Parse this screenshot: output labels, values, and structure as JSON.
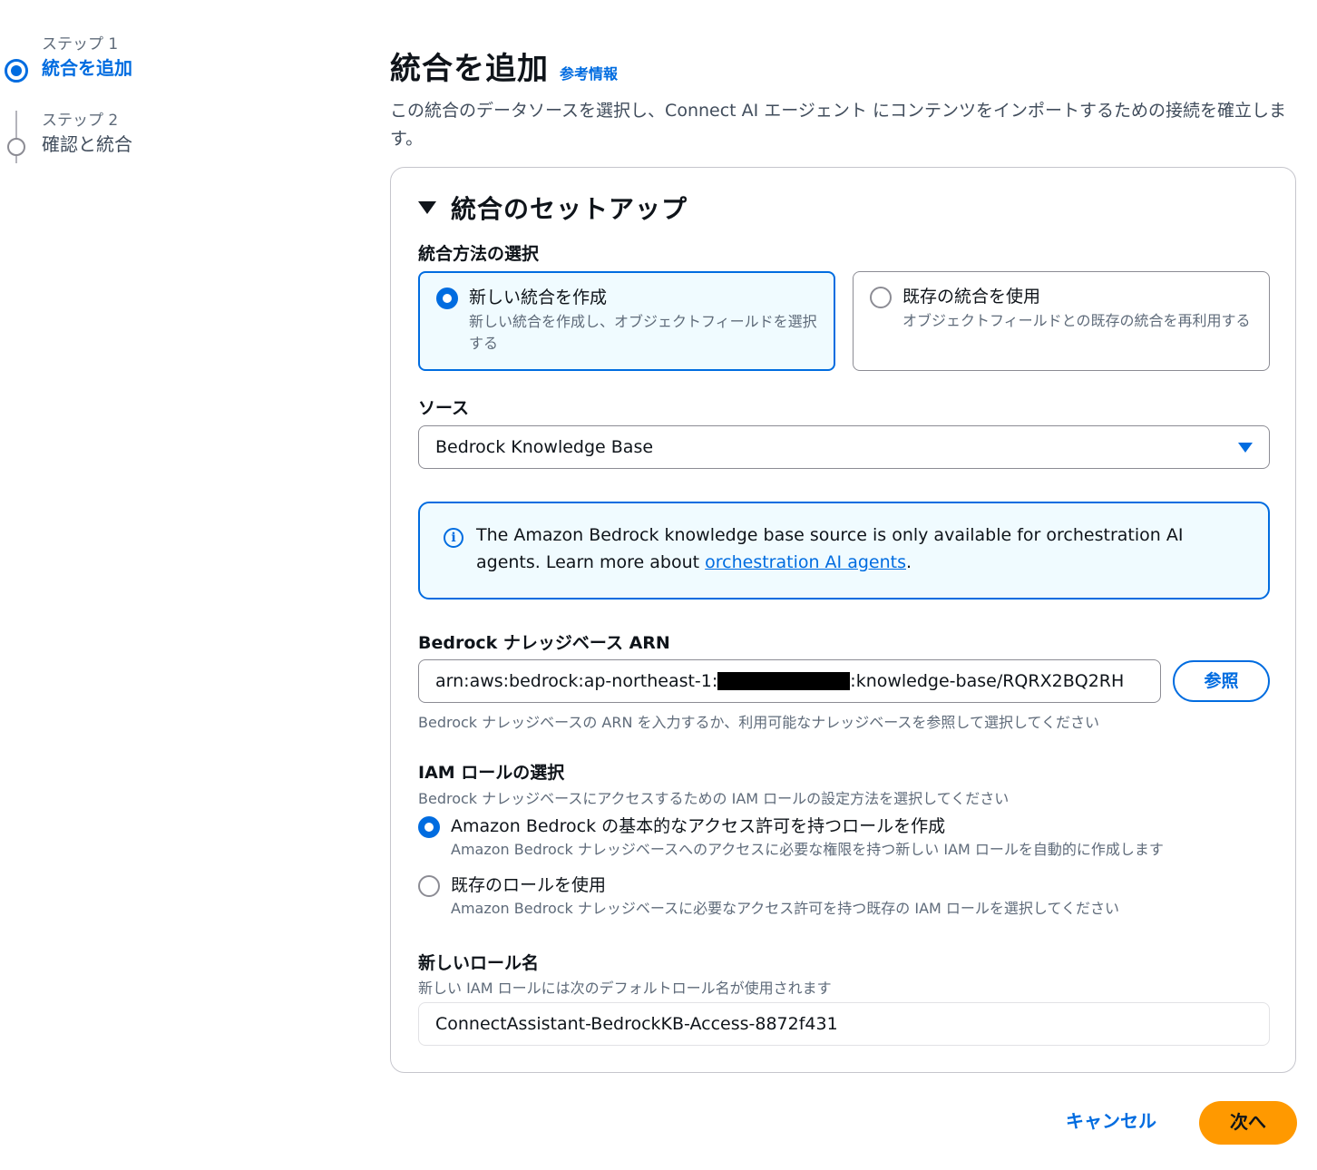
{
  "steps": [
    {
      "sub": "ステップ 1",
      "title": "統合を追加"
    },
    {
      "sub": "ステップ 2",
      "title": "確認と統合"
    }
  ],
  "header": {
    "title": "統合を追加",
    "info_link": "参考情報",
    "description": "この統合のデータソースを選択し、Connect AI エージェント にコンテンツをインポートするための接続を確立します。"
  },
  "section": {
    "title": "統合のセットアップ",
    "method_label": "統合方法の選択",
    "tiles": [
      {
        "title": "新しい統合を作成",
        "desc": "新しい統合を作成し、オブジェクトフィールドを選択する"
      },
      {
        "title": "既存の統合を使用",
        "desc": "オブジェクトフィールドとの既存の統合を再利用する"
      }
    ],
    "source_label": "ソース",
    "source_value": "Bedrock Knowledge Base",
    "alert": {
      "text_before": "The Amazon Bedrock knowledge base source is only available for orchestration AI agents. Learn more about ",
      "link": "orchestration AI agents",
      "text_after": "."
    },
    "arn_label": "Bedrock ナレッジベース ARN",
    "arn_prefix": "arn:aws:bedrock:ap-northeast-1:",
    "arn_suffix": ":knowledge-base/RQRX2BQ2RH",
    "browse_label": "参照",
    "arn_hint": "Bedrock ナレッジベースの ARN を入力するか、利用可能なナレッジベースを参照して選択してください",
    "iam_label": "IAM ロールの選択",
    "iam_hint": "Bedrock ナレッジベースにアクセスするための IAM ロールの設定方法を選択してください",
    "iam_options": [
      {
        "title": "Amazon Bedrock の基本的なアクセス許可を持つロールを作成",
        "desc": "Amazon Bedrock ナレッジベースへのアクセスに必要な権限を持つ新しい IAM ロールを自動的に作成します"
      },
      {
        "title": "既存のロールを使用",
        "desc": "Amazon Bedrock ナレッジベースに必要なアクセス許可を持つ既存の IAM ロールを選択してください"
      }
    ],
    "role_name_label": "新しいロール名",
    "role_name_hint": "新しい IAM ロールには次のデフォルトロール名が使用されます",
    "role_name_value": "ConnectAssistant-BedrockKB-Access-8872f431"
  },
  "footer": {
    "cancel": "キャンセル",
    "next": "次へ"
  },
  "colors": {
    "accent": "#006ce0",
    "primary_button": "#ff9900"
  }
}
